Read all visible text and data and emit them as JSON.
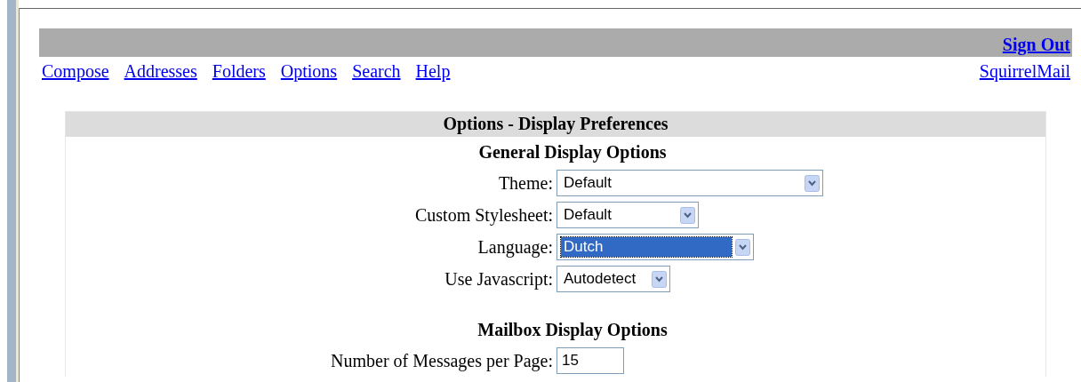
{
  "top_bar": {
    "sign_out": "Sign Out"
  },
  "nav": {
    "links": [
      "Compose",
      "Addresses",
      "Folders",
      "Options",
      "Search",
      "Help"
    ],
    "brand_link": "SquirrelMail"
  },
  "panel": {
    "title": "Options - Display Preferences",
    "sections": [
      {
        "heading": "General Display Options",
        "fields": [
          {
            "kind": "select",
            "label": "Theme:",
            "value": "Default",
            "focused": false
          },
          {
            "kind": "select",
            "label": "Custom Stylesheet:",
            "value": "Default",
            "focused": false
          },
          {
            "kind": "select",
            "label": "Language:",
            "value": "Dutch",
            "focused": true
          },
          {
            "kind": "select",
            "label": "Use Javascript:",
            "value": "Autodetect",
            "focused": false
          }
        ]
      },
      {
        "heading": "Mailbox Display Options",
        "fields": [
          {
            "kind": "text",
            "label": "Number of Messages per Page:",
            "value": "15",
            "focused": false
          }
        ]
      }
    ]
  }
}
